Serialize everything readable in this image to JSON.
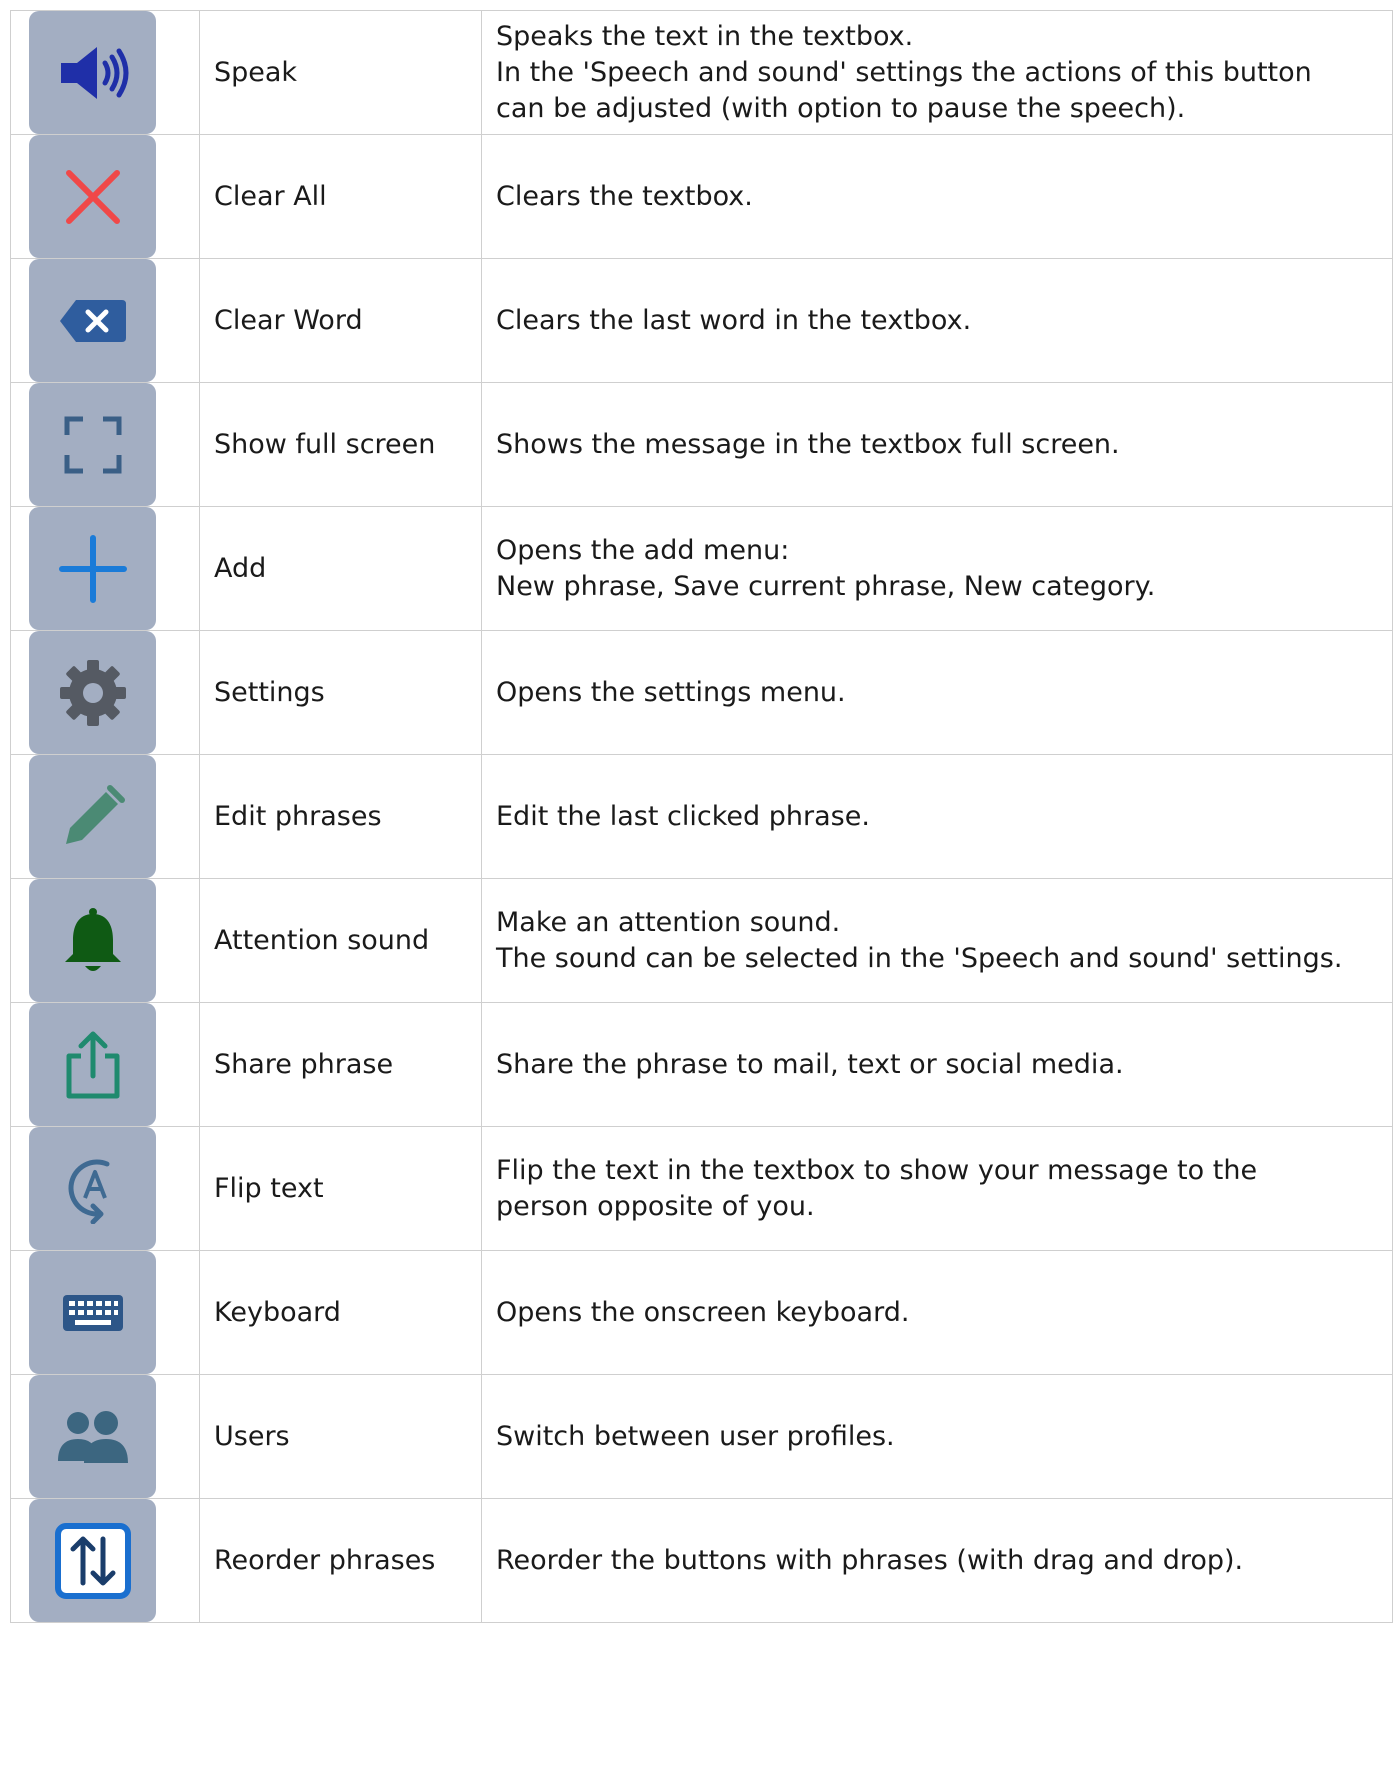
{
  "rows": [
    {
      "icon": "speaker-icon",
      "name": "Speak",
      "desc": [
        "Speaks the text in the textbox.",
        "In the 'Speech and sound' settings the actions of this button",
        "can be adjusted (with option to pause the speech)."
      ]
    },
    {
      "icon": "close-icon",
      "name": "Clear All",
      "desc": [
        "Clears the textbox."
      ]
    },
    {
      "icon": "backspace-icon",
      "name": "Clear Word",
      "desc": [
        "Clears the last word in the textbox."
      ]
    },
    {
      "icon": "fullscreen-icon",
      "name": "Show full screen",
      "desc": [
        "Shows the message in the textbox full screen."
      ]
    },
    {
      "icon": "plus-icon",
      "name": "Add",
      "desc": [
        "Opens the add menu:",
        "New phrase, Save current phrase, New category."
      ]
    },
    {
      "icon": "gear-icon",
      "name": "Settings",
      "desc": [
        "Opens the settings menu."
      ]
    },
    {
      "icon": "pencil-icon",
      "name": "Edit phrases",
      "desc": [
        "Edit the last clicked phrase."
      ]
    },
    {
      "icon": "bell-icon",
      "name": "Attention sound",
      "desc": [
        "Make an attention sound.",
        "The sound can be selected in the 'Speech and sound' settings."
      ]
    },
    {
      "icon": "share-icon",
      "name": "Share phrase",
      "desc": [
        "Share the phrase to mail, text or social media."
      ]
    },
    {
      "icon": "flip-text-icon",
      "name": "Flip text",
      "desc": [
        "Flip the text in the textbox to show your message to the",
        "person opposite of you."
      ]
    },
    {
      "icon": "keyboard-icon",
      "name": "Keyboard",
      "desc": [
        "Opens the onscreen keyboard."
      ]
    },
    {
      "icon": "users-icon",
      "name": "Users",
      "desc": [
        "Switch between user profiles."
      ]
    },
    {
      "icon": "reorder-icon",
      "name": "Reorder phrases",
      "desc": [
        "Reorder the buttons with phrases (with drag and drop)."
      ]
    }
  ],
  "colors": {
    "tile": "#a3aec2",
    "speaker": "#1f2fa8",
    "close": "#f04848",
    "backspace": "#2f5d9e",
    "fullscreen": "#3a5f86",
    "plus": "#1a7bd8",
    "gear": "#555a63",
    "pencil": "#4b8a74",
    "bell": "#0f5a14",
    "share": "#1f8a6e",
    "flip": "#3f6a92",
    "keyboard": "#2d5688",
    "users": "#3c6680",
    "reorder": "#1a6fcf"
  }
}
